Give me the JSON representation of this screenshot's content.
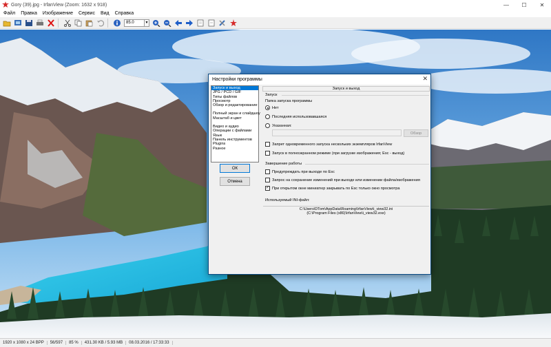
{
  "window": {
    "title": "Gory (39).jpg - IrfanView (Zoom: 1632 x 918)",
    "controls": [
      "—",
      "☐",
      "✕"
    ]
  },
  "menu": [
    "Файл",
    "Правка",
    "Изображение",
    "Сервис",
    "Вид",
    "Справка"
  ],
  "toolbar": {
    "zoom_value": "85.0"
  },
  "status": {
    "dims": "1920 x 1080 x 24 BPP",
    "index": "56/597",
    "zoom": "85 %",
    "size": "431.30 KB / 5.93 MB",
    "datetime": "08.03.2016 / 17:33:33"
  },
  "dialog": {
    "title": "Настройки программы",
    "close": "✕",
    "categories": [
      [
        "Запуск и выход",
        "JPG / PCD / GIF",
        "Типы файлов",
        "Просмотр",
        "Обзор и редактирование"
      ],
      [
        "Полный экран и слайдшоу",
        "Масштаб и цвет"
      ],
      [
        "Видео и аудио",
        "Операции с файлами",
        "Язык",
        "Панель инструментов",
        "Plugins",
        "Разное"
      ]
    ],
    "ok": "ОК",
    "cancel": "Отмена",
    "panel_title": "Запуск и выход",
    "group_start": "Запуск",
    "startup_folder_label": "Папка запуска программы",
    "radio": [
      "Нет",
      "Последняя использовавшаяся",
      "Указанная:"
    ],
    "browse": "Обзор",
    "check_multi": "Запрет одновременного запуска нескольких экземпляров IrfanView",
    "check_fullscreen": "Запуск в полноэкранном режиме (при загрузке изображения; Esc - выход)",
    "group_exit": "Завершение работы",
    "check_warn_esc": "Предупреждать при выходе по Esc",
    "check_save_query": "Запрос на сохранение изменений при выходе или изменении файла/изображения",
    "check_thumbs": "При открытом окне миниатюр закрывать по Esc только окно просмотра",
    "ini_label": "Используемый INI-файл:",
    "ini_path1": "C:\\Users\\DTom\\AppData\\Roaming\\IrfanView\\i_view32.ini",
    "ini_path2": "(C:\\Program Files (x86)\\IrfanView\\i_view32.exe)"
  }
}
